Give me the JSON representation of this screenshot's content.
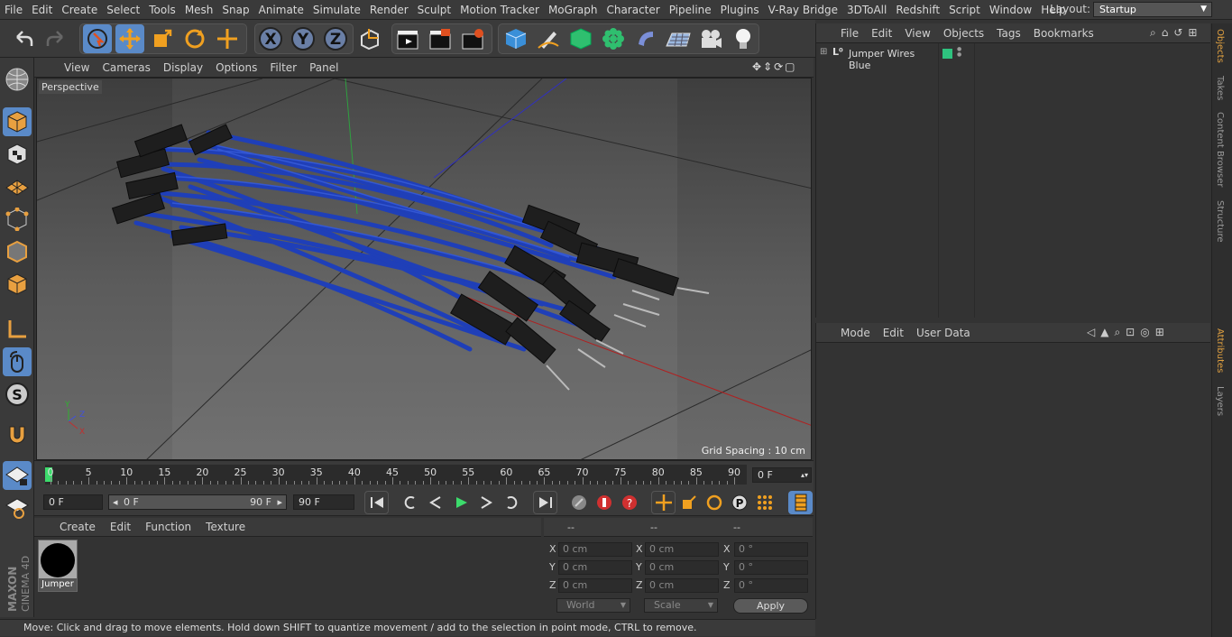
{
  "menubar": {
    "items": [
      "File",
      "Edit",
      "Create",
      "Select",
      "Tools",
      "Mesh",
      "Snap",
      "Animate",
      "Simulate",
      "Render",
      "Sculpt",
      "Motion Tracker",
      "MoGraph",
      "Character",
      "Pipeline",
      "Plugins",
      "V-Ray Bridge",
      "3DToAll",
      "Redshift",
      "Script",
      "Window",
      "Help"
    ],
    "layout_label": "Layout:",
    "layout_value": "Startup"
  },
  "viewport": {
    "menu": [
      "View",
      "Cameras",
      "Display",
      "Options",
      "Filter",
      "Panel"
    ],
    "camera_label": "Perspective",
    "grid_spacing": "Grid Spacing : 10 cm"
  },
  "timeline": {
    "ticks": [
      "0",
      "5",
      "10",
      "15",
      "20",
      "25",
      "30",
      "35",
      "40",
      "45",
      "50",
      "55",
      "60",
      "65",
      "70",
      "75",
      "80",
      "85",
      "90"
    ],
    "current_frame": "0 F"
  },
  "transport": {
    "start_field": "0 F",
    "range_start": "0 F",
    "range_end": "90 F",
    "end_field": "90 F"
  },
  "material_panel": {
    "menu": [
      "Create",
      "Edit",
      "Function",
      "Texture"
    ],
    "material_name": "Jumper"
  },
  "coordinates": {
    "headers": [
      "--",
      "--",
      "--"
    ],
    "pos": {
      "x": "0 cm",
      "y": "0 cm",
      "z": "0 cm"
    },
    "size": {
      "x": "0 cm",
      "y": "0 cm",
      "z": "0 cm"
    },
    "rot": {
      "x": "0 °",
      "y": "0 °",
      "z": "0 °"
    },
    "axis_x": "X",
    "axis_y": "Y",
    "axis_z": "Z",
    "mode_world": "World",
    "mode_scale": "Scale",
    "apply": "Apply"
  },
  "status_bar": "Move: Click and drag to move elements. Hold down SHIFT to quantize movement / add to the selection in point mode, CTRL to remove.",
  "objects_panel": {
    "menu": [
      "File",
      "Edit",
      "View",
      "Objects",
      "Tags",
      "Bookmarks"
    ],
    "object_name": "Jumper Wires Blue",
    "layer_color": "#2ec27e"
  },
  "attributes_panel": {
    "menu": [
      "Mode",
      "Edit",
      "User Data"
    ]
  },
  "right_tabs": [
    "Objects",
    "Takes",
    "Content Browser",
    "Structure",
    "Attributes",
    "Layers"
  ],
  "brand": "MAXON CINEMA 4D",
  "colors": {
    "accent": "#5a8ac8",
    "wire": "#1f3fb8"
  }
}
